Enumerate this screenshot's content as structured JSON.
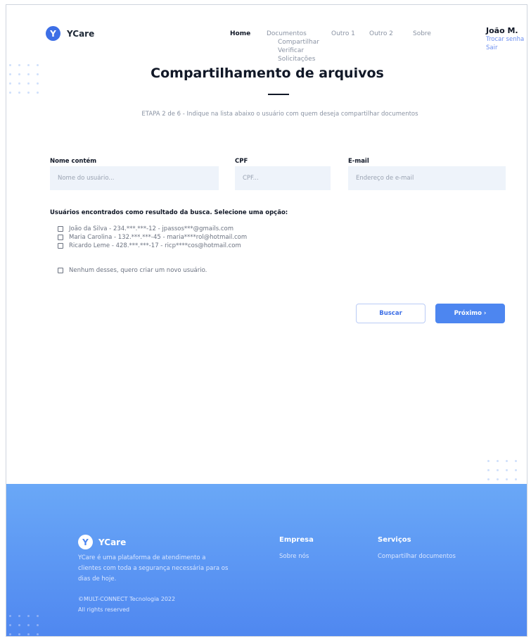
{
  "brand": {
    "name": "YCare",
    "mark": "Y"
  },
  "nav": {
    "home": "Home",
    "documentos": "Documentos",
    "documentos_sub": [
      "Compartilhar",
      "Verificar",
      "Solicitações"
    ],
    "outro1": "Outro 1",
    "outro2": "Outro 2",
    "sobre": "Sobre"
  },
  "user": {
    "name": "João M.",
    "change_password": "Trocar senha",
    "logout": "Sair"
  },
  "page": {
    "title": "Compartilhamento de arquivos",
    "step": "ETAPA 2 de 6 - Indique na lista abaixo o usuário com quem deseja compartilhar documentos"
  },
  "form": {
    "name_label": "Nome contém",
    "name_placeholder": "Nome do usuário...",
    "cpf_label": "CPF",
    "cpf_placeholder": "CPF...",
    "email_label": "E-mail",
    "email_placeholder": "Endereço de e-mail"
  },
  "results": {
    "title": "Usuários encontrados como resultado da busca. Selecione uma opção:",
    "options": [
      "João da Silva  - 234.***.***-12 - jpassos***@gmails.com",
      "Maria Carolina - 132.***.***-45 - maria****rol@hotmail.com",
      "Ricardo Leme - 428.***.***-17 - ricp****cos@hotmail.com"
    ],
    "none_option": "Nenhum desses, quero criar um novo usuário."
  },
  "actions": {
    "search": "Buscar",
    "next": "Próximo ›"
  },
  "footer": {
    "brand": "YCare",
    "description": "YCare é uma plataforma de atendimento a clientes com toda a segurança necessária para os dias de hoje.",
    "copyright": "©MULT-CONNECT Tecnologia 2022",
    "rights": "All rights reserved",
    "company_heading": "Empresa",
    "company_link": "Sobre nós",
    "services_heading": "Serviços",
    "services_link": "Compartilhar documentos"
  },
  "colors": {
    "accent": "#4d86f0",
    "footer_top": "#6aa8f7",
    "footer_bottom": "#4f87f0",
    "input_bg": "#eef3fa"
  }
}
